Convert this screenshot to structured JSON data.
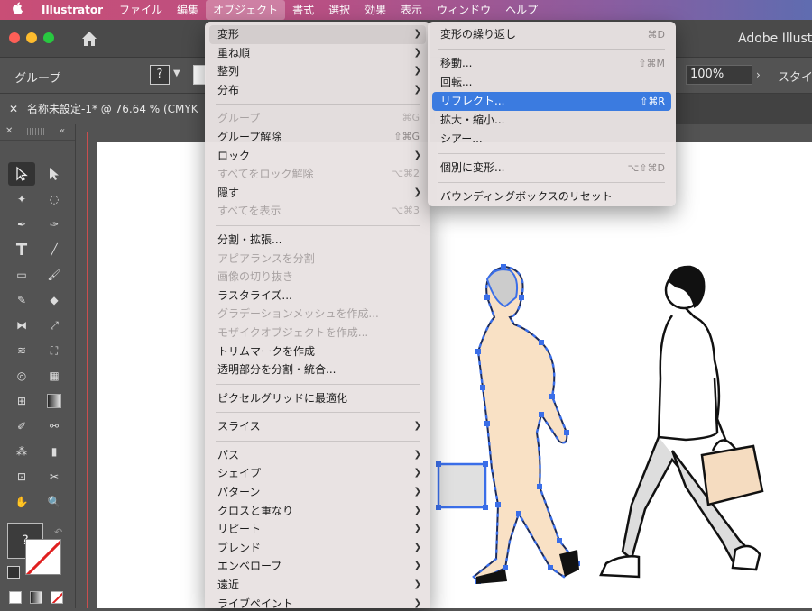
{
  "menubar": {
    "app": "Illustrator",
    "items": [
      "ファイル",
      "編集",
      "オブジェクト",
      "書式",
      "選択",
      "効果",
      "表示",
      "ウィンドウ",
      "ヘルプ"
    ],
    "active_index": 2
  },
  "titlebar": {
    "app_name": "Adobe Illustrator"
  },
  "control_bar": {
    "selection_label": "グループ",
    "unknown_fill": "?",
    "opacity": "100%",
    "style_label": "スタイル"
  },
  "document": {
    "tab_title": "名称未設定-1* @ 76.64 % (CMYK"
  },
  "toolbox": {
    "fill_unknown": "?"
  },
  "object_menu": {
    "items": [
      {
        "label": "変形",
        "submenu": true,
        "hover": true
      },
      {
        "label": "重ね順",
        "submenu": true
      },
      {
        "label": "整列",
        "submenu": true
      },
      {
        "label": "分布",
        "submenu": true
      },
      {
        "sep": true
      },
      {
        "label": "グループ",
        "shortcut": "⌘G",
        "disabled": true
      },
      {
        "label": "グループ解除",
        "shortcut": "⇧⌘G"
      },
      {
        "label": "ロック",
        "submenu": true
      },
      {
        "label": "すべてをロック解除",
        "shortcut": "⌥⌘2",
        "disabled": true
      },
      {
        "label": "隠す",
        "submenu": true
      },
      {
        "label": "すべてを表示",
        "shortcut": "⌥⌘3",
        "disabled": true
      },
      {
        "sep": true
      },
      {
        "label": "分割・拡張..."
      },
      {
        "label": "アピアランスを分割",
        "disabled": true
      },
      {
        "label": "画像の切り抜き",
        "disabled": true
      },
      {
        "label": "ラスタライズ..."
      },
      {
        "label": "グラデーションメッシュを作成...",
        "disabled": true
      },
      {
        "label": "モザイクオブジェクトを作成...",
        "disabled": true
      },
      {
        "label": "トリムマークを作成"
      },
      {
        "label": "透明部分を分割・統合..."
      },
      {
        "sep": true
      },
      {
        "label": "ピクセルグリッドに最適化"
      },
      {
        "sep": true
      },
      {
        "label": "スライス",
        "submenu": true
      },
      {
        "sep": true
      },
      {
        "label": "パス",
        "submenu": true
      },
      {
        "label": "シェイプ",
        "submenu": true
      },
      {
        "label": "パターン",
        "submenu": true
      },
      {
        "label": "クロスと重なり",
        "submenu": true
      },
      {
        "label": "リピート",
        "submenu": true
      },
      {
        "label": "ブレンド",
        "submenu": true
      },
      {
        "label": "エンベロープ",
        "submenu": true
      },
      {
        "label": "遠近",
        "submenu": true
      },
      {
        "label": "ライブペイント",
        "submenu": true
      }
    ]
  },
  "transform_submenu": {
    "items": [
      {
        "label": "変形の繰り返し",
        "shortcut": "⌘D"
      },
      {
        "sep": true
      },
      {
        "label": "移動...",
        "shortcut": "⇧⌘M"
      },
      {
        "label": "回転..."
      },
      {
        "label": "リフレクト...",
        "shortcut": "⇧⌘R",
        "highlighted": true
      },
      {
        "label": "拡大・縮小..."
      },
      {
        "label": "シアー..."
      },
      {
        "sep": true
      },
      {
        "label": "個別に変形...",
        "shortcut": "⌥⇧⌘D"
      },
      {
        "sep": true
      },
      {
        "label": "バウンディングボックスのリセット"
      }
    ]
  },
  "colors": {
    "highlight": "#3b7be0",
    "selection_path": "#3a6ee8",
    "skin_fill": "#f9e1c5",
    "bag_fill": "#f5dcc0"
  }
}
